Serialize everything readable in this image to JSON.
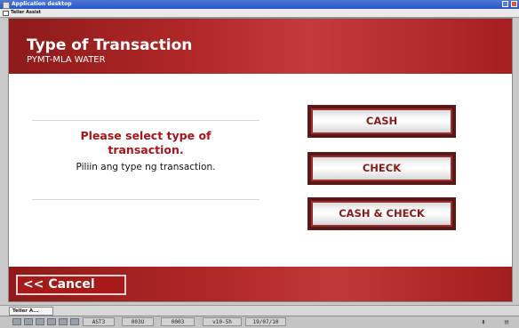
{
  "window": {
    "title": "Application desktop",
    "icon": "app-window-icon"
  },
  "subwindow": {
    "title": "Teller Assist"
  },
  "header": {
    "title": "Type of Transaction",
    "subtitle": "PYMT-MLA WATER"
  },
  "prompt": {
    "main": "Please select type of transaction.",
    "sub": "Piliin ang type ng transaction."
  },
  "options": [
    {
      "label": "CASH"
    },
    {
      "label": "CHECK"
    },
    {
      "label": "CASH & CHECK"
    }
  ],
  "footer": {
    "cancel_label": "<< Cancel"
  },
  "taskbar": {
    "tab_label": "Teller A..."
  },
  "statusbar": {
    "fields": [
      "AST3",
      "003U",
      "0003",
      "v10-5h",
      "19/07/10"
    ]
  },
  "colors": {
    "brand_red": "#b02727",
    "prompt_red": "#a8141b",
    "titlebar_blue": "#2a57c4"
  }
}
